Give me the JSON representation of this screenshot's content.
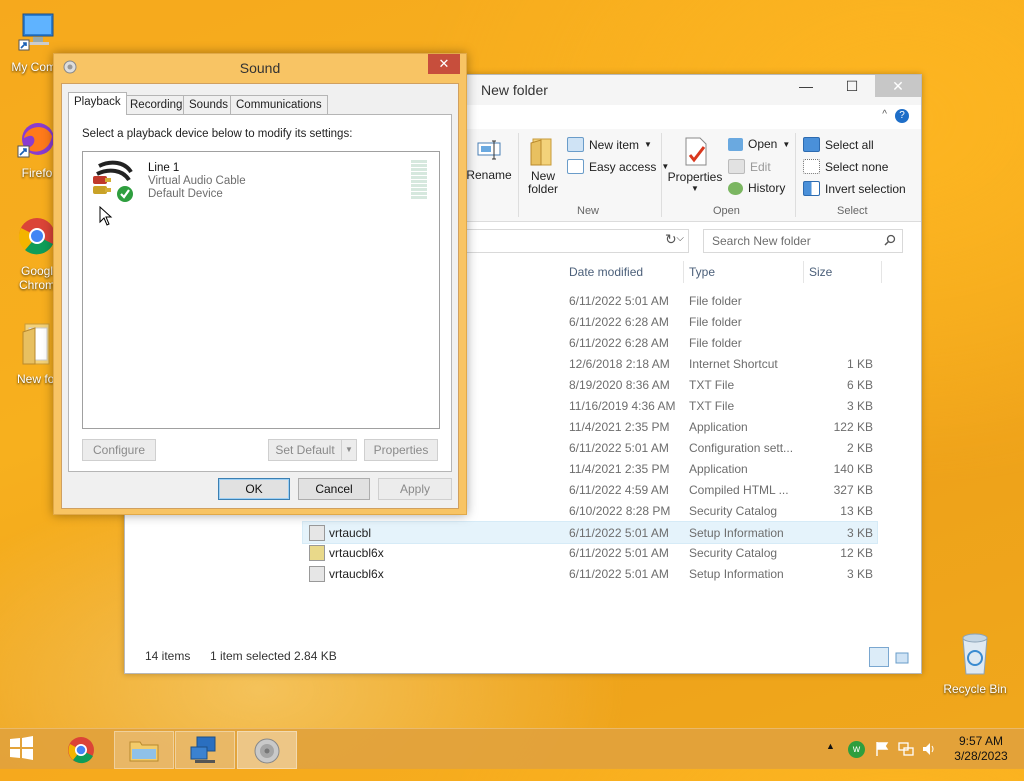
{
  "desktop": {
    "icons": [
      {
        "label": "My Comp"
      },
      {
        "label": "Firefo"
      },
      {
        "label": "Googl Chrom"
      },
      {
        "label": "New fol"
      },
      {
        "label": "Recycle Bin"
      }
    ]
  },
  "explorer": {
    "title": "New folder",
    "controls": {
      "minimize": "—",
      "maximize": "☐",
      "close": "✕"
    },
    "ribbon": {
      "rename": "Rename",
      "new_folder": "New folder",
      "new_item": "New item",
      "easy_access": "Easy access",
      "group_new": "New",
      "properties": "Properties",
      "open": "Open",
      "edit": "Edit",
      "history": "History",
      "group_open": "Open",
      "select_all": "Select all",
      "select_none": "Select none",
      "invert_selection": "Invert selection",
      "group_select": "Select"
    },
    "search_placeholder": "Search New folder",
    "columns": {
      "date": "Date modified",
      "type": "Type",
      "size": "Size"
    },
    "rows": [
      {
        "name": "",
        "date": "6/11/2022 5:01 AM",
        "type": "File folder",
        "size": ""
      },
      {
        "name": "",
        "date": "6/11/2022 6:28 AM",
        "type": "File folder",
        "size": ""
      },
      {
        "name": "",
        "date": "6/11/2022 6:28 AM",
        "type": "File folder",
        "size": ""
      },
      {
        "name": "",
        "date": "12/6/2018 2:18 AM",
        "type": "Internet Shortcut",
        "size": "1 KB"
      },
      {
        "name": "",
        "date": "8/19/2020 8:36 AM",
        "type": "TXT File",
        "size": "6 KB"
      },
      {
        "name": "",
        "date": "11/16/2019 4:36 AM",
        "type": "TXT File",
        "size": "3 KB"
      },
      {
        "name": "",
        "date": "11/4/2021 2:35 PM",
        "type": "Application",
        "size": "122 KB"
      },
      {
        "name": "",
        "date": "6/11/2022 5:01 AM",
        "type": "Configuration sett...",
        "size": "2 KB"
      },
      {
        "name": "",
        "date": "11/4/2021 2:35 PM",
        "type": "Application",
        "size": "140 KB"
      },
      {
        "name": "",
        "date": "6/11/2022 4:59 AM",
        "type": "Compiled HTML ...",
        "size": "327 KB"
      },
      {
        "name": "",
        "date": "6/10/2022 8:28 PM",
        "type": "Security Catalog",
        "size": "13 KB"
      },
      {
        "name": "vrtaucbl",
        "date": "6/11/2022 5:01 AM",
        "type": "Setup Information",
        "size": "3 KB"
      },
      {
        "name": "vrtaucbl6x",
        "date": "6/11/2022 5:01 AM",
        "type": "Security Catalog",
        "size": "12 KB"
      },
      {
        "name": "vrtaucbl6x",
        "date": "6/11/2022 5:01 AM",
        "type": "Setup Information",
        "size": "3 KB"
      }
    ],
    "status": {
      "count": "14 items",
      "selection": "1 item selected  2.84 KB"
    }
  },
  "sound": {
    "title": "Sound",
    "close": "✕",
    "tabs": [
      "Playback",
      "Recording",
      "Sounds",
      "Communications"
    ],
    "instruction": "Select a playback device below to modify its settings:",
    "device": {
      "name": "Line 1",
      "desc": "Virtual Audio Cable",
      "status": "Default Device"
    },
    "buttons": {
      "configure": "Configure",
      "set_default": "Set Default",
      "properties": "Properties",
      "ok": "OK",
      "cancel": "Cancel",
      "apply": "Apply"
    }
  },
  "taskbar": {
    "time": "9:57 AM",
    "date": "3/28/2023"
  }
}
